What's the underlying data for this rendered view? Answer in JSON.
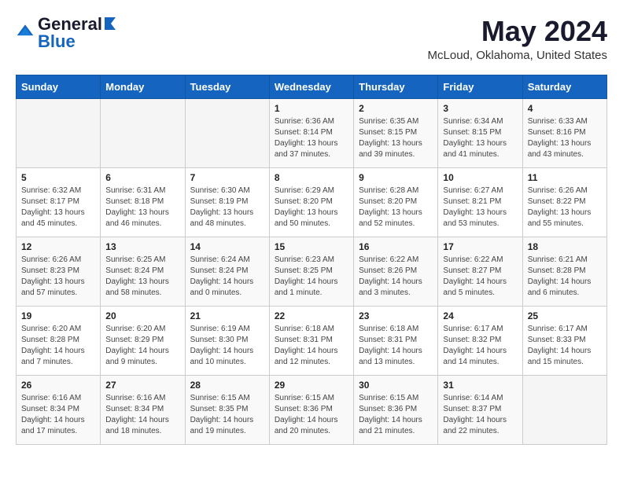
{
  "header": {
    "logo_general": "General",
    "logo_blue": "Blue",
    "month_year": "May 2024",
    "location": "McLoud, Oklahoma, United States"
  },
  "days_of_week": [
    "Sunday",
    "Monday",
    "Tuesday",
    "Wednesday",
    "Thursday",
    "Friday",
    "Saturday"
  ],
  "weeks": [
    [
      {
        "day": "",
        "info": ""
      },
      {
        "day": "",
        "info": ""
      },
      {
        "day": "",
        "info": ""
      },
      {
        "day": "1",
        "info": "Sunrise: 6:36 AM\nSunset: 8:14 PM\nDaylight: 13 hours\nand 37 minutes."
      },
      {
        "day": "2",
        "info": "Sunrise: 6:35 AM\nSunset: 8:15 PM\nDaylight: 13 hours\nand 39 minutes."
      },
      {
        "day": "3",
        "info": "Sunrise: 6:34 AM\nSunset: 8:15 PM\nDaylight: 13 hours\nand 41 minutes."
      },
      {
        "day": "4",
        "info": "Sunrise: 6:33 AM\nSunset: 8:16 PM\nDaylight: 13 hours\nand 43 minutes."
      }
    ],
    [
      {
        "day": "5",
        "info": "Sunrise: 6:32 AM\nSunset: 8:17 PM\nDaylight: 13 hours\nand 45 minutes."
      },
      {
        "day": "6",
        "info": "Sunrise: 6:31 AM\nSunset: 8:18 PM\nDaylight: 13 hours\nand 46 minutes."
      },
      {
        "day": "7",
        "info": "Sunrise: 6:30 AM\nSunset: 8:19 PM\nDaylight: 13 hours\nand 48 minutes."
      },
      {
        "day": "8",
        "info": "Sunrise: 6:29 AM\nSunset: 8:20 PM\nDaylight: 13 hours\nand 50 minutes."
      },
      {
        "day": "9",
        "info": "Sunrise: 6:28 AM\nSunset: 8:20 PM\nDaylight: 13 hours\nand 52 minutes."
      },
      {
        "day": "10",
        "info": "Sunrise: 6:27 AM\nSunset: 8:21 PM\nDaylight: 13 hours\nand 53 minutes."
      },
      {
        "day": "11",
        "info": "Sunrise: 6:26 AM\nSunset: 8:22 PM\nDaylight: 13 hours\nand 55 minutes."
      }
    ],
    [
      {
        "day": "12",
        "info": "Sunrise: 6:26 AM\nSunset: 8:23 PM\nDaylight: 13 hours\nand 57 minutes."
      },
      {
        "day": "13",
        "info": "Sunrise: 6:25 AM\nSunset: 8:24 PM\nDaylight: 13 hours\nand 58 minutes."
      },
      {
        "day": "14",
        "info": "Sunrise: 6:24 AM\nSunset: 8:24 PM\nDaylight: 14 hours\nand 0 minutes."
      },
      {
        "day": "15",
        "info": "Sunrise: 6:23 AM\nSunset: 8:25 PM\nDaylight: 14 hours\nand 1 minute."
      },
      {
        "day": "16",
        "info": "Sunrise: 6:22 AM\nSunset: 8:26 PM\nDaylight: 14 hours\nand 3 minutes."
      },
      {
        "day": "17",
        "info": "Sunrise: 6:22 AM\nSunset: 8:27 PM\nDaylight: 14 hours\nand 5 minutes."
      },
      {
        "day": "18",
        "info": "Sunrise: 6:21 AM\nSunset: 8:28 PM\nDaylight: 14 hours\nand 6 minutes."
      }
    ],
    [
      {
        "day": "19",
        "info": "Sunrise: 6:20 AM\nSunset: 8:28 PM\nDaylight: 14 hours\nand 7 minutes."
      },
      {
        "day": "20",
        "info": "Sunrise: 6:20 AM\nSunset: 8:29 PM\nDaylight: 14 hours\nand 9 minutes."
      },
      {
        "day": "21",
        "info": "Sunrise: 6:19 AM\nSunset: 8:30 PM\nDaylight: 14 hours\nand 10 minutes."
      },
      {
        "day": "22",
        "info": "Sunrise: 6:18 AM\nSunset: 8:31 PM\nDaylight: 14 hours\nand 12 minutes."
      },
      {
        "day": "23",
        "info": "Sunrise: 6:18 AM\nSunset: 8:31 PM\nDaylight: 14 hours\nand 13 minutes."
      },
      {
        "day": "24",
        "info": "Sunrise: 6:17 AM\nSunset: 8:32 PM\nDaylight: 14 hours\nand 14 minutes."
      },
      {
        "day": "25",
        "info": "Sunrise: 6:17 AM\nSunset: 8:33 PM\nDaylight: 14 hours\nand 15 minutes."
      }
    ],
    [
      {
        "day": "26",
        "info": "Sunrise: 6:16 AM\nSunset: 8:34 PM\nDaylight: 14 hours\nand 17 minutes."
      },
      {
        "day": "27",
        "info": "Sunrise: 6:16 AM\nSunset: 8:34 PM\nDaylight: 14 hours\nand 18 minutes."
      },
      {
        "day": "28",
        "info": "Sunrise: 6:15 AM\nSunset: 8:35 PM\nDaylight: 14 hours\nand 19 minutes."
      },
      {
        "day": "29",
        "info": "Sunrise: 6:15 AM\nSunset: 8:36 PM\nDaylight: 14 hours\nand 20 minutes."
      },
      {
        "day": "30",
        "info": "Sunrise: 6:15 AM\nSunset: 8:36 PM\nDaylight: 14 hours\nand 21 minutes."
      },
      {
        "day": "31",
        "info": "Sunrise: 6:14 AM\nSunset: 8:37 PM\nDaylight: 14 hours\nand 22 minutes."
      },
      {
        "day": "",
        "info": ""
      }
    ]
  ],
  "colors": {
    "header_bg": "#1565c0",
    "accent": "#1565c0",
    "logo_dark": "#1a1a2e",
    "logo_blue": "#1565c0"
  }
}
